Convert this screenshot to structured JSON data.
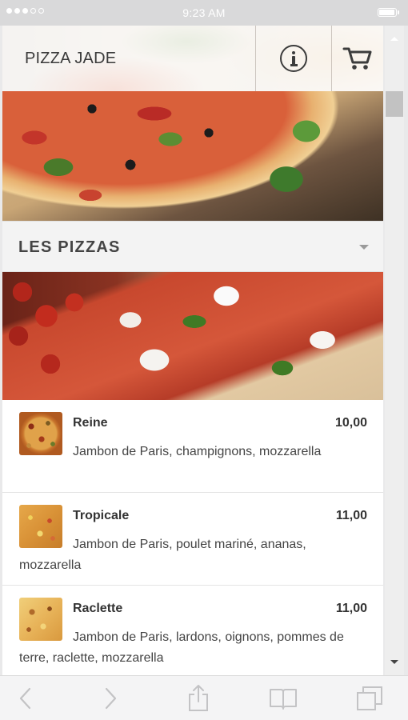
{
  "statusbar": {
    "time": "9:23 AM",
    "signal_icon": "signal-dots-icon",
    "battery_icon": "battery-icon"
  },
  "header": {
    "brand": "PIZZA JADE",
    "info_icon": "info-icon",
    "cart_icon": "cart-icon"
  },
  "section": {
    "title": "LES PIZZAS",
    "toggle_icon": "chevron-down-icon"
  },
  "menu": {
    "items": [
      {
        "name": "Reine",
        "price": "10,00",
        "description": "Jambon de Paris, champignons, mozzarella"
      },
      {
        "name": "Tropicale",
        "price": "11,00",
        "description": "Jambon de Paris, poulet mariné, ananas, mozzarella"
      },
      {
        "name": "Raclette",
        "price": "11,00",
        "description": "Jambon de Paris, lardons, oignons, pommes de terre, raclette, mozzarella"
      }
    ]
  },
  "toolbar": {
    "icons": [
      "back-icon",
      "forward-icon",
      "share-icon",
      "bookmarks-icon",
      "tabs-icon"
    ]
  },
  "colors": {
    "background": "#e9e9ea",
    "text": "#333333",
    "statusbar": "#d9d9da"
  }
}
